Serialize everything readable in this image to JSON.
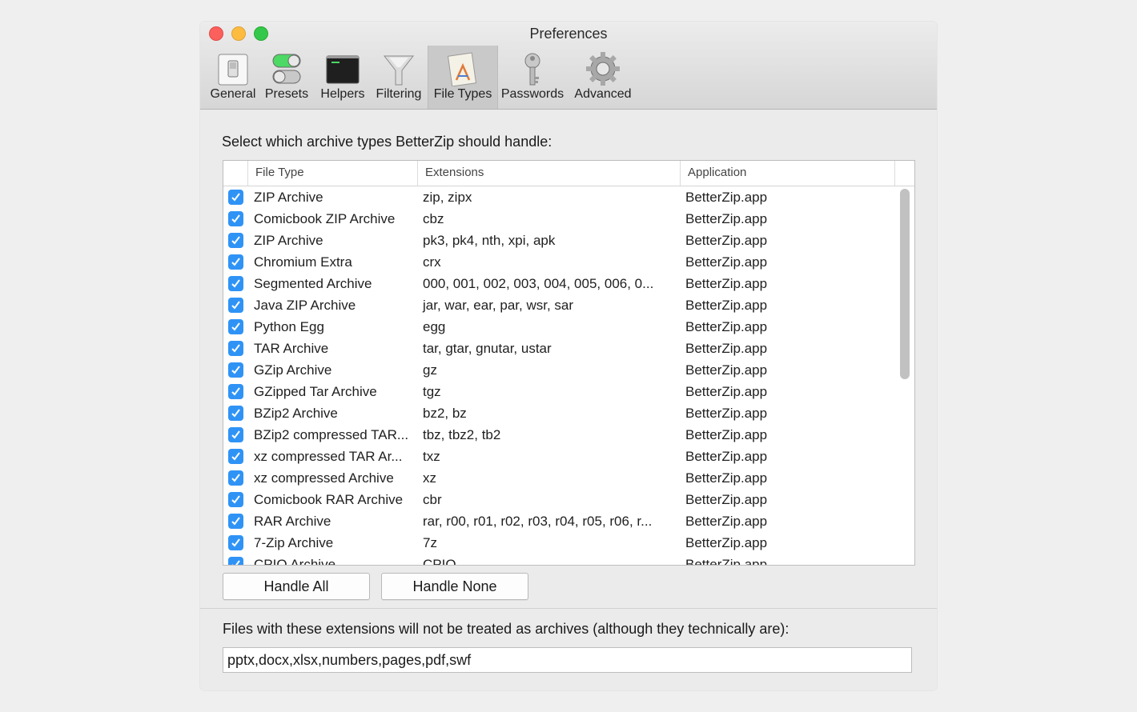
{
  "window": {
    "title": "Preferences"
  },
  "toolbar": {
    "tabs": [
      {
        "label": "General",
        "icon": "switch-icon"
      },
      {
        "label": "Presets",
        "icon": "toggles-icon"
      },
      {
        "label": "Helpers",
        "icon": "terminal-icon"
      },
      {
        "label": "Filtering",
        "icon": "funnel-icon"
      },
      {
        "label": "File Types",
        "icon": "document-app-icon",
        "active": true
      },
      {
        "label": "Passwords",
        "icon": "key-icon"
      },
      {
        "label": "Advanced",
        "icon": "gear-icon"
      }
    ]
  },
  "main": {
    "heading": "Select which archive types BetterZip should handle:",
    "columns": [
      "File Type",
      "Extensions",
      "Application"
    ],
    "rows": [
      {
        "checked": true,
        "type": "ZIP Archive",
        "ext": "zip, zipx",
        "app": "BetterZip.app"
      },
      {
        "checked": true,
        "type": "Comicbook ZIP Archive",
        "ext": "cbz",
        "app": "BetterZip.app"
      },
      {
        "checked": true,
        "type": "ZIP Archive",
        "ext": "pk3, pk4, nth, xpi, apk",
        "app": "BetterZip.app"
      },
      {
        "checked": true,
        "type": "Chromium Extra",
        "ext": "crx",
        "app": "BetterZip.app"
      },
      {
        "checked": true,
        "type": "Segmented Archive",
        "ext": "000, 001, 002, 003, 004, 005, 006, 0...",
        "app": "BetterZip.app"
      },
      {
        "checked": true,
        "type": "Java ZIP Archive",
        "ext": "jar, war, ear, par, wsr, sar",
        "app": "BetterZip.app"
      },
      {
        "checked": true,
        "type": "Python Egg",
        "ext": "egg",
        "app": "BetterZip.app"
      },
      {
        "checked": true,
        "type": "TAR Archive",
        "ext": "tar, gtar, gnutar, ustar",
        "app": "BetterZip.app"
      },
      {
        "checked": true,
        "type": "GZip Archive",
        "ext": "gz",
        "app": "BetterZip.app"
      },
      {
        "checked": true,
        "type": "GZipped Tar Archive",
        "ext": "tgz",
        "app": "BetterZip.app"
      },
      {
        "checked": true,
        "type": "BZip2 Archive",
        "ext": "bz2, bz",
        "app": "BetterZip.app"
      },
      {
        "checked": true,
        "type": "BZip2 compressed TAR...",
        "ext": "tbz, tbz2, tb2",
        "app": "BetterZip.app"
      },
      {
        "checked": true,
        "type": "xz compressed TAR Ar...",
        "ext": "txz",
        "app": "BetterZip.app"
      },
      {
        "checked": true,
        "type": "xz compressed Archive",
        "ext": "xz",
        "app": "BetterZip.app"
      },
      {
        "checked": true,
        "type": "Comicbook RAR Archive",
        "ext": "cbr",
        "app": "BetterZip.app"
      },
      {
        "checked": true,
        "type": "RAR Archive",
        "ext": "rar, r00, r01, r02, r03, r04, r05, r06, r...",
        "app": "BetterZip.app"
      },
      {
        "checked": true,
        "type": "7-Zip Archive",
        "ext": "7z",
        "app": "BetterZip.app"
      },
      {
        "checked": true,
        "type": "CPIO Archive",
        "ext": "CPIO",
        "app": "BetterZip.app"
      }
    ],
    "handle_all_label": "Handle All",
    "handle_none_label": "Handle None"
  },
  "exclusions": {
    "label": "Files with these extensions will not be treated as archives (although they technically are):",
    "value": "pptx,docx,xlsx,numbers,pages,pdf,swf"
  },
  "colors": {
    "accent": "#2f93f6",
    "close": "#fc605c",
    "minimize": "#fdbc40",
    "zoom": "#34c84a"
  }
}
